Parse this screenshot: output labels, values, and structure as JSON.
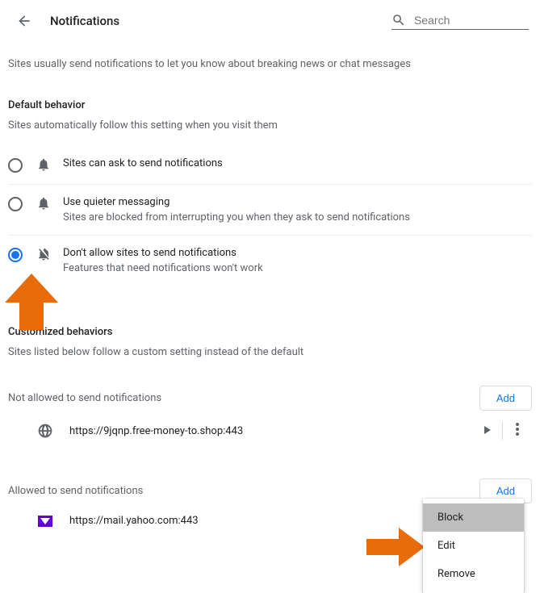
{
  "header": {
    "title": "Notifications",
    "search_placeholder": "Search"
  },
  "intro": "Sites usually send notifications to let you know about breaking news or chat messages",
  "default_behavior": {
    "heading": "Default behavior",
    "sub": "Sites automatically follow this setting when you visit them",
    "options": [
      {
        "title": "Sites can ask to send notifications",
        "sub": "",
        "selected": false,
        "icon": "bell"
      },
      {
        "title": "Use quieter messaging",
        "sub": "Sites are blocked from interrupting you when they ask to send notifications",
        "selected": false,
        "icon": "bell"
      },
      {
        "title": "Don't allow sites to send notifications",
        "sub": "Features that need notifications won't work",
        "selected": true,
        "icon": "bell-off"
      }
    ]
  },
  "custom": {
    "heading": "Customized behaviors",
    "sub": "Sites listed below follow a custom setting instead of the default"
  },
  "blocked": {
    "heading": "Not allowed to send notifications",
    "add": "Add",
    "sites": [
      {
        "url": "https://9jqnp.free-money-to.shop:443",
        "icon": "globe"
      }
    ]
  },
  "allowed": {
    "heading": "Allowed to send notifications",
    "add": "Add",
    "sites": [
      {
        "url": "https://mail.yahoo.com:443",
        "icon": "yahoo"
      }
    ]
  },
  "menu": {
    "items": [
      "Block",
      "Edit",
      "Remove"
    ],
    "hover_index": 0
  }
}
